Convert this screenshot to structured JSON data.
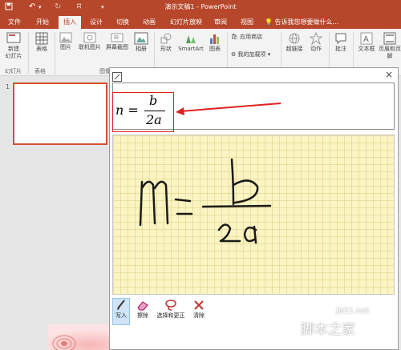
{
  "titlebar": {
    "title": "演示文稿1 - PowerPoint"
  },
  "tabs": [
    "文件",
    "开始",
    "插入",
    "设计",
    "切换",
    "动画",
    "幻灯片放映",
    "审阅",
    "视图"
  ],
  "tell_me": "告诉我您想要做什么...",
  "ribbon": {
    "new_slide": "新建\n幻灯片",
    "table": "表格",
    "picture": "图片",
    "online_picture": "联机图片",
    "screenshot": "屏幕截图",
    "album": "相册",
    "shapes": "形状",
    "smartart": "SmartArt",
    "chart": "图表",
    "store": "应用商店",
    "my_addins": "我的加载项",
    "hyperlink": "超链接",
    "action": "动作",
    "comment": "批注",
    "textbox": "文本框",
    "header_footer": "页眉和页脚",
    "groups": {
      "slides": "幻灯片",
      "tables": "表格",
      "images": "图像"
    }
  },
  "slide_pane": {
    "slide_number": "1"
  },
  "dialog": {
    "preview_formula": {
      "lhs": "n =",
      "numerator": "b",
      "denominator": "2a"
    },
    "tools": [
      {
        "label": "写入",
        "icon": "pen-icon"
      },
      {
        "label": "擦除",
        "icon": "eraser-icon"
      },
      {
        "label": "选择和更正",
        "icon": "lasso-icon"
      },
      {
        "label": "清除",
        "icon": "clear-icon"
      }
    ],
    "close": "×"
  },
  "watermark": {
    "site": "jb51.net",
    "name": "脚本之家"
  },
  "colors": {
    "accent": "#b7472a",
    "highlight": "#e02020",
    "pad": "#fbf4c3"
  }
}
